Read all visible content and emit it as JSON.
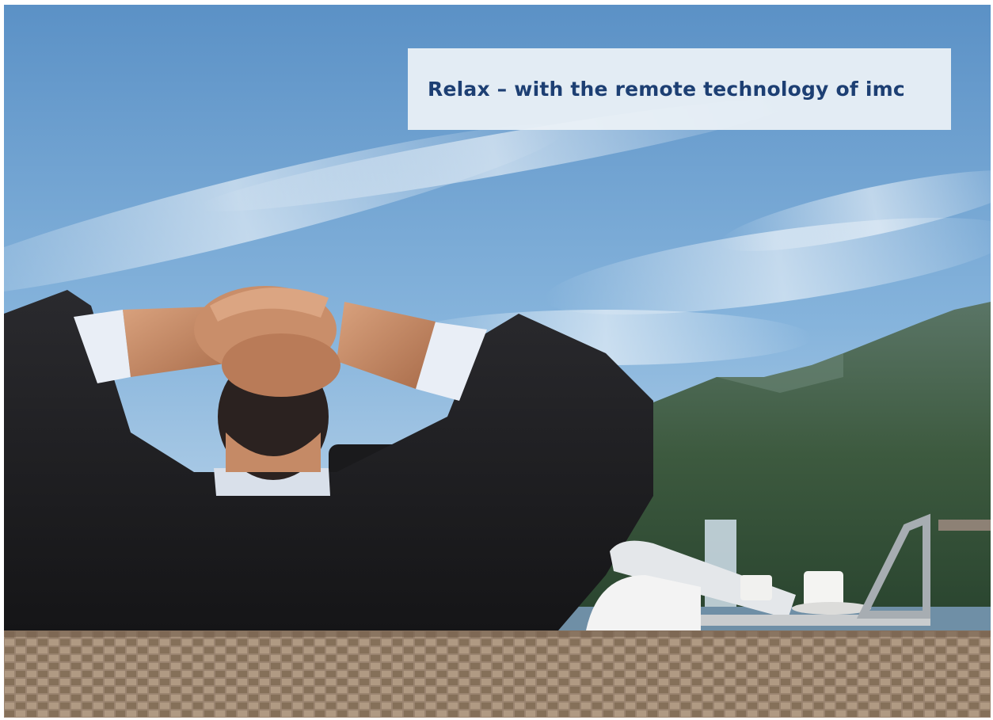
{
  "caption": {
    "text": "Relax – with the remote technology of imc"
  },
  "scene": {
    "description_icon": "photo-businessman-relaxing-terrace-mountains",
    "colors": {
      "sky_top": "#5d93c7",
      "sky_mid": "#8ab8df",
      "sky_low": "#c7dcee",
      "mountain": "#3a5b3f",
      "suit": "#1c1c1e",
      "wicker": "#9f8a72",
      "caption_text": "#1d3f73"
    }
  }
}
